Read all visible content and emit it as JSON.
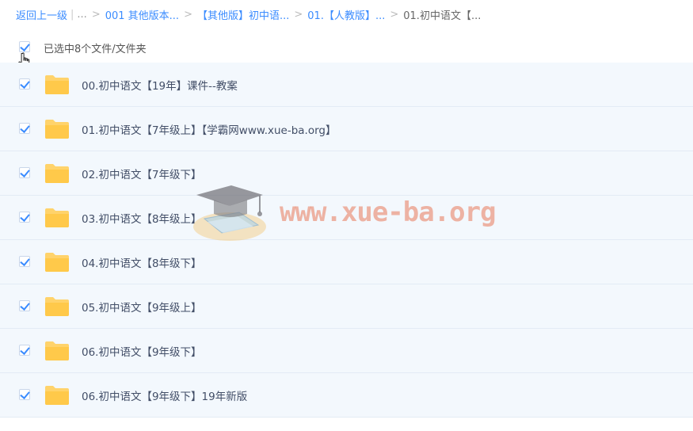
{
  "breadcrumb": {
    "back": "返回上一级",
    "pipe": "|",
    "dots": "...",
    "sep": ">",
    "items": [
      "001 其他版本...",
      "【其他版】初中语...",
      "01.【人教版】..."
    ],
    "current": "01.初中语文【..."
  },
  "selection": {
    "text": "已选中8个文件/文件夹",
    "checked": true
  },
  "files": [
    {
      "name": "00.初中语文【19年】课件--教案",
      "checked": true,
      "icon": "folder-icon"
    },
    {
      "name": "01.初中语文【7年级上】【学霸网www.xue-ba.org】",
      "checked": true,
      "icon": "folder-icon"
    },
    {
      "name": "02.初中语文【7年级下】",
      "checked": true,
      "icon": "folder-icon"
    },
    {
      "name": "03.初中语文【8年级上】",
      "checked": true,
      "icon": "folder-icon"
    },
    {
      "name": "04.初中语文【8年级下】",
      "checked": true,
      "icon": "folder-icon"
    },
    {
      "name": "05.初中语文【9年级上】",
      "checked": true,
      "icon": "folder-icon"
    },
    {
      "name": "06.初中语文【9年级下】",
      "checked": true,
      "icon": "folder-icon"
    },
    {
      "name": "06.初中语文【9年级下】19年新版",
      "checked": true,
      "icon": "folder-icon"
    }
  ],
  "watermark": {
    "text": "www.xue-ba.org"
  },
  "colors": {
    "accent": "#3b8cff",
    "row_bg": "#f3f8fd",
    "folder": "#ffd36b",
    "watermark": "#e8785a"
  }
}
